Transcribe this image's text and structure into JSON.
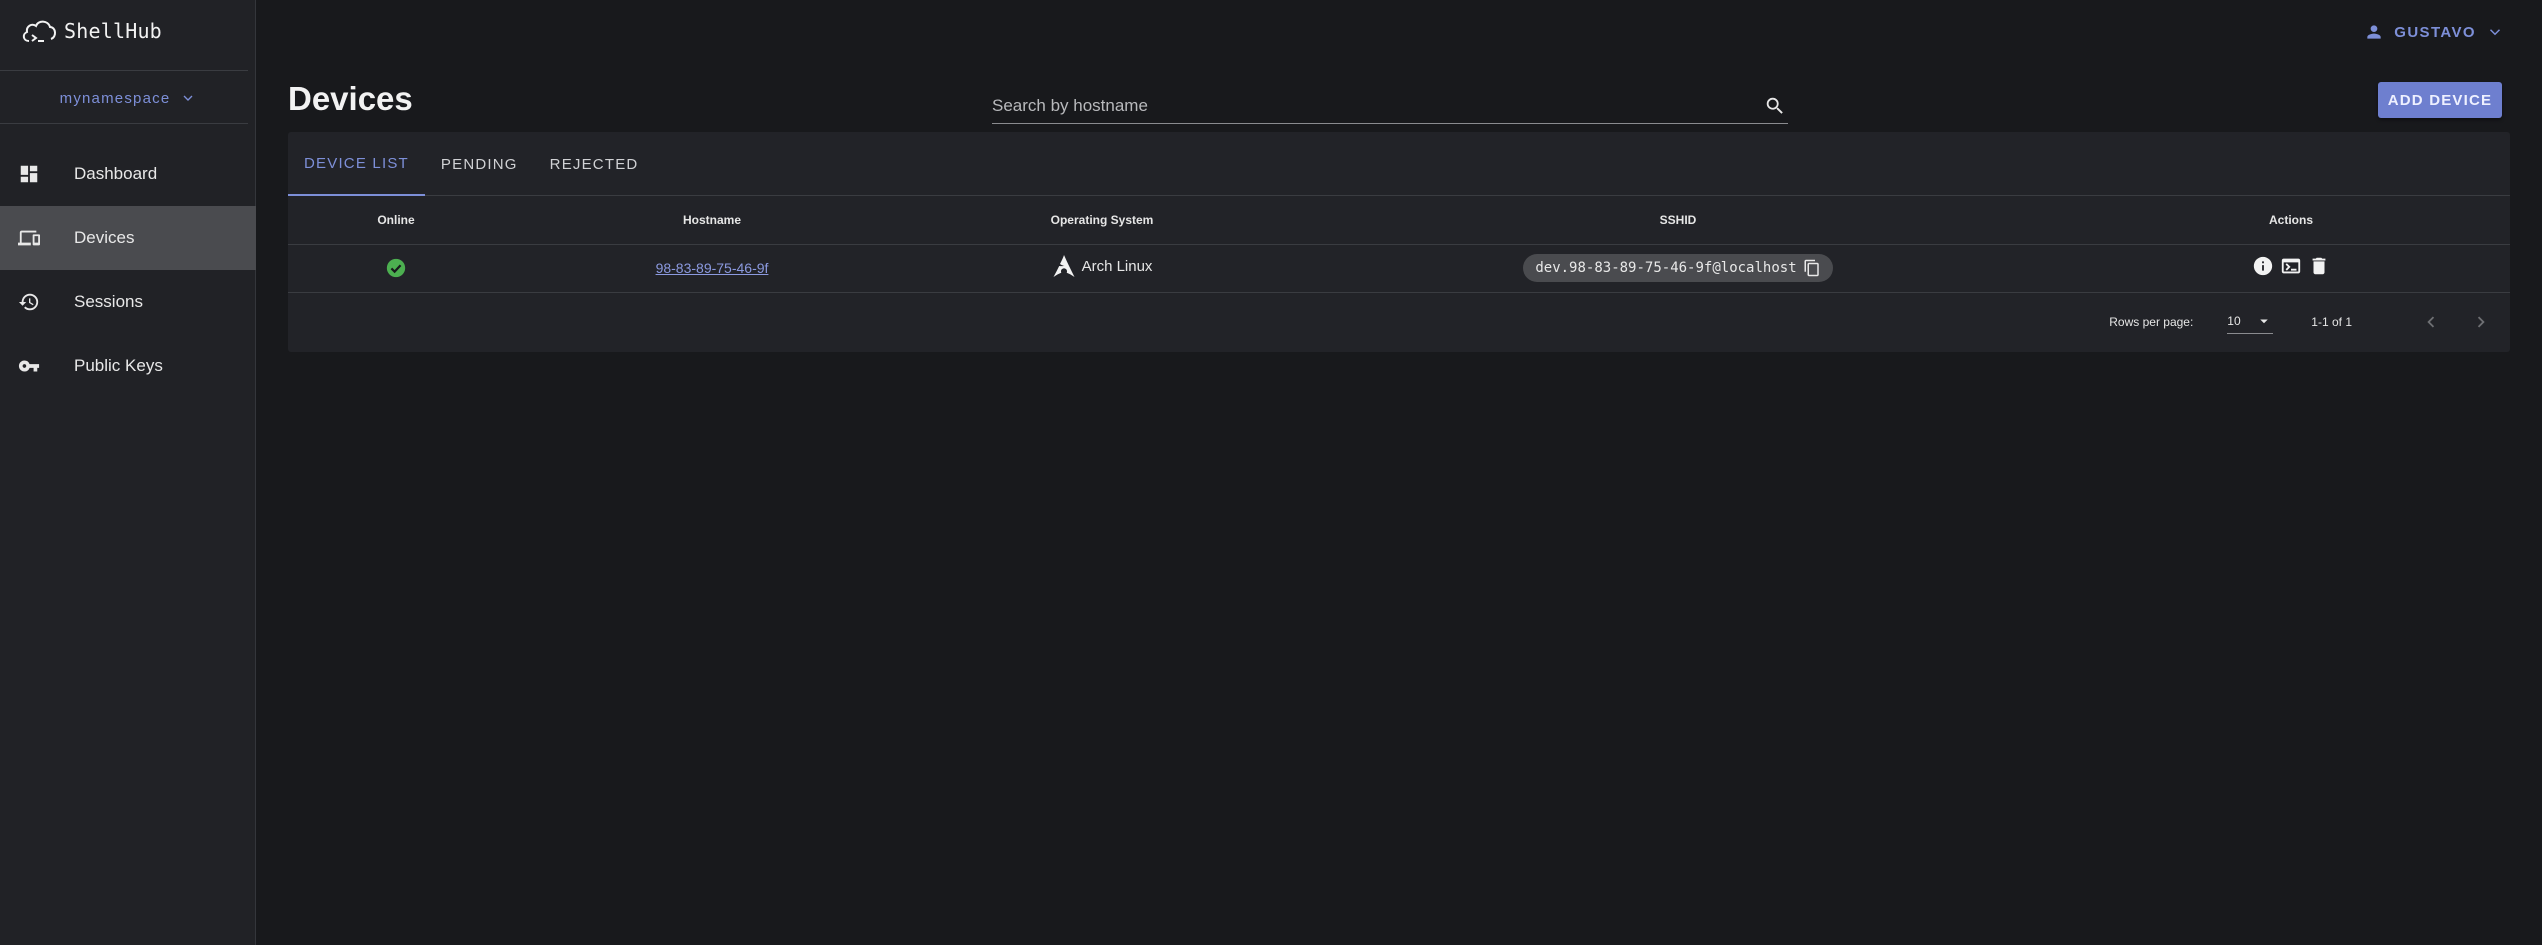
{
  "app": {
    "brand": "ShellHub"
  },
  "sidebar": {
    "namespace": "mynamespace",
    "items": [
      {
        "label": "Dashboard",
        "icon": "dashboard-icon",
        "active": false
      },
      {
        "label": "Devices",
        "icon": "devices-icon",
        "active": true
      },
      {
        "label": "Sessions",
        "icon": "history-icon",
        "active": false
      },
      {
        "label": "Public Keys",
        "icon": "key-icon",
        "active": false
      }
    ]
  },
  "header": {
    "user": "GUSTAVO",
    "page_title": "Devices",
    "search_placeholder": "Search by hostname",
    "add_button": "ADD DEVICE"
  },
  "tabs": [
    {
      "label": "DEVICE LIST",
      "active": true
    },
    {
      "label": "PENDING",
      "active": false
    },
    {
      "label": "REJECTED",
      "active": false
    }
  ],
  "table": {
    "columns": [
      "Online",
      "Hostname",
      "Operating System",
      "SSHID",
      "Actions"
    ],
    "rows": [
      {
        "online": true,
        "hostname": "98-83-89-75-46-9f",
        "os": "Arch Linux",
        "sshid": "dev.98-83-89-75-46-9f@localhost"
      }
    ]
  },
  "pagination": {
    "rows_per_page_label": "Rows per page:",
    "rows_per_page": "10",
    "range": "1-1 of 1"
  },
  "colors": {
    "accent": "#7d8fd8",
    "button": "#6e7fcf",
    "online": "#4caf50",
    "background": "#18191c",
    "sidebar": "#212226"
  }
}
